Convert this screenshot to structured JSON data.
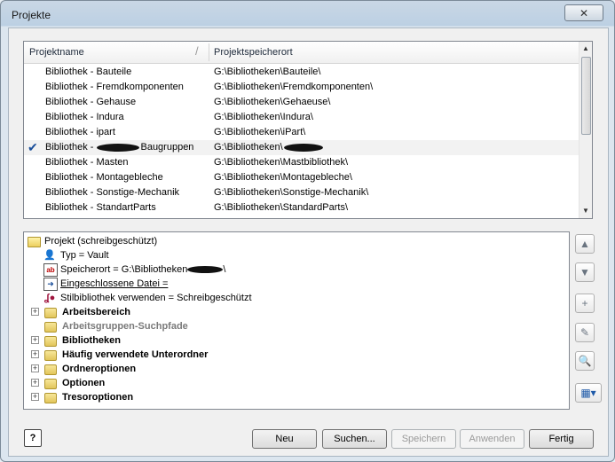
{
  "window": {
    "title": "Projekte",
    "close_glyph": "✕"
  },
  "projects": {
    "columns": [
      "Projektname",
      "Projektspeicherort"
    ],
    "rows": [
      {
        "name": "Bibliothek - Bauteile",
        "path": "G:\\Bibliotheken\\Bauteile\\"
      },
      {
        "name": "Bibliothek - Fremdkomponenten",
        "path": "G:\\Bibliotheken\\Fremdkomponenten\\"
      },
      {
        "name": "Bibliothek - Gehause",
        "path": "G:\\Bibliotheken\\Gehaeuse\\"
      },
      {
        "name": "Bibliothek - Indura",
        "path": "G:\\Bibliotheken\\Indura\\"
      },
      {
        "name": "Bibliothek - ipart",
        "path": "G:\\Bibliotheken\\iPart\\"
      },
      {
        "name_prefix": "Bibliothek - ",
        "name_suffix": "Baugruppen",
        "path": "G:\\Bibliotheken\\",
        "active": true,
        "check": "✔"
      },
      {
        "name": "Bibliothek - Masten",
        "path": "G:\\Bibliotheken\\Mastbibliothek\\"
      },
      {
        "name": "Bibliothek - Montagebleche",
        "path": "G:\\Bibliotheken\\Montagebleche\\"
      },
      {
        "name": "Bibliothek - Sonstige-Mechanik",
        "path": "G:\\Bibliotheken\\Sonstige-Mechanik\\"
      },
      {
        "name": "Bibliothek - StandartParts",
        "path": "G:\\Bibliotheken\\StandardParts\\"
      }
    ]
  },
  "tree": {
    "root": "Projekt (schreibgeschützt)",
    "type": "Typ = Vault",
    "location_prefix": "Speicherort = G:\\Bibliotheken",
    "location_suffix": "\\",
    "included_file": "Eingeschlossene Datei =",
    "style_library": "Stilbibliothek verwenden = Schreibgeschützt",
    "groups": [
      {
        "label": "Arbeitsbereich",
        "expandable": true
      },
      {
        "label": "Arbeitsgruppen-Suchpfade",
        "expandable": false,
        "disabled": true
      },
      {
        "label": "Bibliotheken",
        "expandable": true
      },
      {
        "label": "Häufig verwendete Unterordner",
        "expandable": true
      },
      {
        "label": "Ordneroptionen",
        "expandable": true
      },
      {
        "label": "Optionen",
        "expandable": true
      },
      {
        "label": "Tresoroptionen",
        "expandable": true
      }
    ],
    "expand_glyph": "+"
  },
  "tools": {
    "up": "▲",
    "down": "▼",
    "add": "+",
    "edit": "✎",
    "find": "🔍",
    "options": "▦▾"
  },
  "buttons": {
    "help": "?",
    "new": "Neu",
    "browse": "Suchen...",
    "save": "Speichern",
    "apply": "Anwenden",
    "done": "Fertig"
  }
}
